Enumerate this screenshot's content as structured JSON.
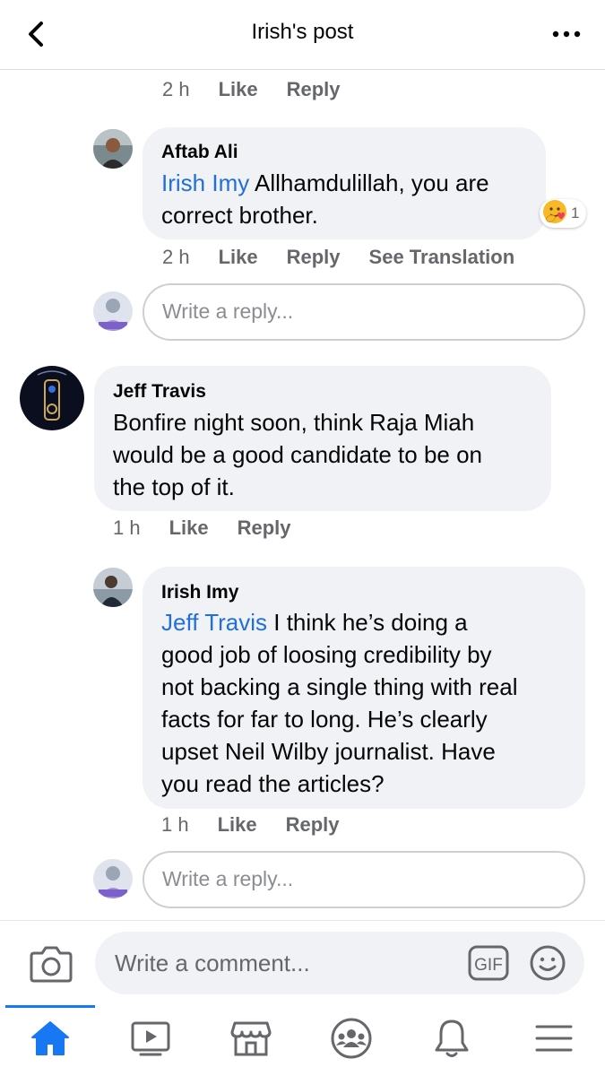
{
  "header": {
    "title": "Irish's post"
  },
  "comments": [
    {
      "time": "2 h",
      "like": "Like",
      "reply": "Reply"
    },
    {
      "author": "Aftab Ali",
      "mention": "Irish Imy",
      "text_line1": "Allhamdulillah, you are",
      "text_line2": "correct brother.",
      "reaction_count": "1",
      "time": "2 h",
      "like": "Like",
      "reply": "Reply",
      "translation": "See Translation"
    },
    {
      "author": "Jeff Travis",
      "lines": [
        "Bonfire night soon, think Raja Miah",
        "would be a good candidate to be on",
        "the top of it."
      ],
      "time": "1 h",
      "like": "Like",
      "reply": "Reply"
    },
    {
      "author": "Irish Imy",
      "mention": "Jeff Travis",
      "first_line_rest": "I think he’s doing a",
      "lines": [
        "good job of loosing credibility by",
        "not backing a single thing with real",
        "facts for far to long. He’s clearly",
        "upset Neil Wilby journalist. Have",
        "you read the articles?"
      ],
      "time": "1 h",
      "like": "Like",
      "reply": "Reply"
    }
  ],
  "reply_box": {
    "placeholder": "Write a reply..."
  },
  "composer": {
    "placeholder": "Write a comment...",
    "gif_label": "GIF"
  },
  "tabs": [
    "home",
    "watch",
    "marketplace",
    "groups",
    "notifications",
    "menu"
  ],
  "colors": {
    "accent": "#1877f2",
    "mention": "#216fdb",
    "bubble": "#f0f2f5"
  }
}
